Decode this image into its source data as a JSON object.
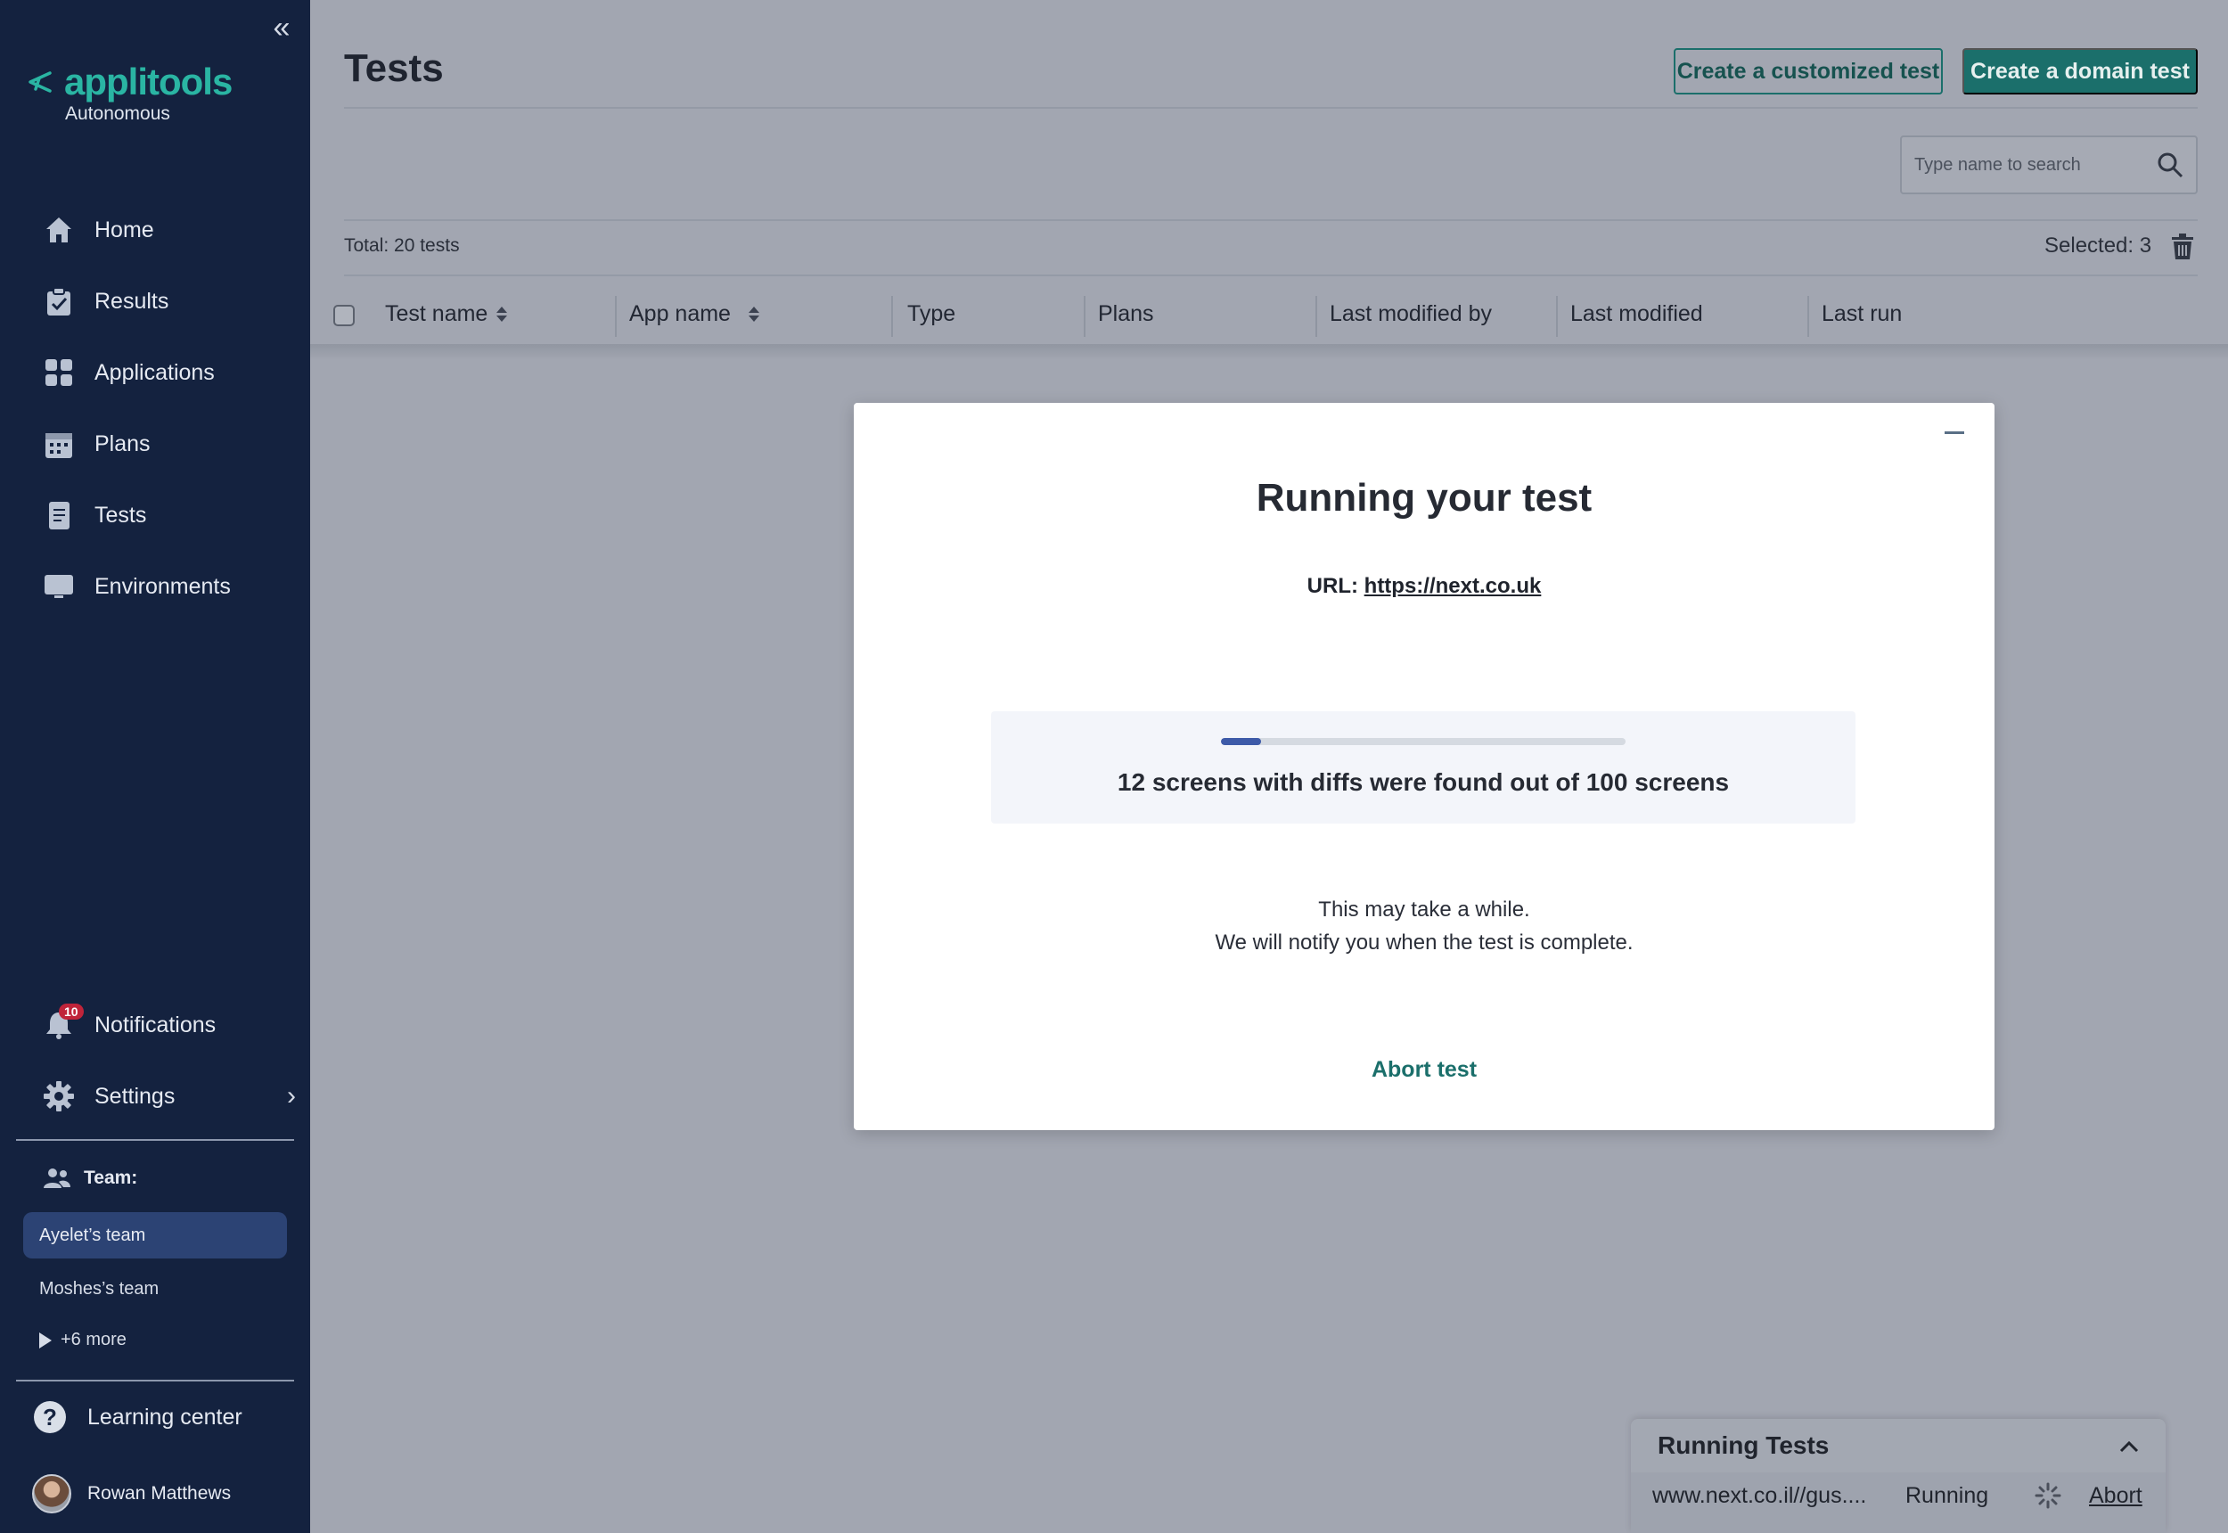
{
  "sidebar": {
    "logo": {
      "name": "applitools",
      "subtitle": "Autonomous"
    },
    "nav": [
      {
        "label": "Home",
        "icon": "home-icon"
      },
      {
        "label": "Results",
        "icon": "clipboard-check-icon"
      },
      {
        "label": "Applications",
        "icon": "grid-icon"
      },
      {
        "label": "Plans",
        "icon": "calendar-icon"
      },
      {
        "label": "Tests",
        "icon": "document-icon"
      },
      {
        "label": "Environments",
        "icon": "monitor-icon"
      }
    ],
    "notifications": {
      "label": "Notifications",
      "count": "10"
    },
    "settings": {
      "label": "Settings"
    },
    "team": {
      "label": "Team:",
      "items": [
        "Ayelet’s team",
        "Moshes’s team"
      ],
      "more": "+6 more"
    },
    "learning_center": "Learning center",
    "user": "Rowan Matthews"
  },
  "main": {
    "title": "Tests",
    "create_custom": "Create a customized test",
    "create_domain": "Create a domain test",
    "search_placeholder": "Type name to search",
    "total": "Total: 20 tests",
    "selected": "Selected: 3",
    "columns": [
      "Test name",
      "App name",
      "Type",
      "Plans",
      "Last modified by",
      "Last modified",
      "Last run"
    ]
  },
  "modal": {
    "title": "Running your test",
    "url_label": "URL:",
    "url": "https://next.co.uk",
    "progress_fraction": 0.1,
    "progress_text": "12 screens with diffs were found out of 100 screens",
    "note_line1": "This may take a while.",
    "note_line2": "We will notify you when the test is complete.",
    "abort": "Abort test"
  },
  "running_tests": {
    "title": "Running Tests",
    "url": "www.next.co.il//gus....",
    "status": "Running",
    "abort": "Abort"
  },
  "colors": {
    "sidebar_bg": "#14223f",
    "accent": "#1b6f6b",
    "logo_teal": "#2ab5a3",
    "progress": "#3d5aa8",
    "badge": "#c0243a"
  }
}
